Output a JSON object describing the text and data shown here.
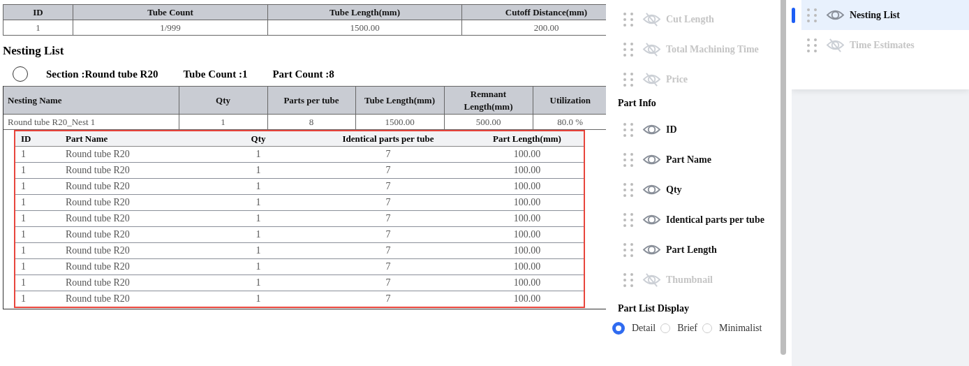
{
  "summary_table": {
    "columns": [
      "ID",
      "Tube Count",
      "Tube Length(mm)",
      "Cutoff Distance(mm)"
    ],
    "rows": [
      [
        "1",
        "1/999",
        "1500.00",
        "200.00"
      ]
    ]
  },
  "nesting_list": {
    "title": "Nesting List",
    "section_info": [
      "Section :Round tube R20",
      "Tube Count :1",
      "Part Count :8"
    ],
    "columns": [
      "Nesting Name",
      "Qty",
      "Parts per tube",
      "Tube Length(mm)",
      "Remnant Length(mm)",
      "Utilization"
    ],
    "rows": [
      [
        "Round tube R20_Nest 1",
        "1",
        "8",
        "1500.00",
        "500.00",
        "80.0 %"
      ]
    ],
    "part_table": {
      "columns": [
        "ID",
        "Part Name",
        "Qty",
        "Identical parts per tube",
        "Part Length(mm)"
      ],
      "rows": [
        [
          "1",
          "Round tube R20",
          "1",
          "7",
          "100.00"
        ],
        [
          "1",
          "Round tube R20",
          "1",
          "7",
          "100.00"
        ],
        [
          "1",
          "Round tube R20",
          "1",
          "7",
          "100.00"
        ],
        [
          "1",
          "Round tube R20",
          "1",
          "7",
          "100.00"
        ],
        [
          "1",
          "Round tube R20",
          "1",
          "7",
          "100.00"
        ],
        [
          "1",
          "Round tube R20",
          "1",
          "7",
          "100.00"
        ],
        [
          "1",
          "Round tube R20",
          "1",
          "7",
          "100.00"
        ],
        [
          "1",
          "Round tube R20",
          "1",
          "7",
          "100.00"
        ],
        [
          "1",
          "Round tube R20",
          "1",
          "7",
          "100.00"
        ],
        [
          "1",
          "Round tube R20",
          "1",
          "7",
          "100.00"
        ]
      ]
    }
  },
  "field_panel": {
    "groups": [
      {
        "items": [
          {
            "label": "Cut Length",
            "visible": false
          },
          {
            "label": "Total Machining Time",
            "visible": false
          },
          {
            "label": "Price",
            "visible": false
          }
        ]
      },
      {
        "title": "Part Info",
        "items": [
          {
            "label": "ID",
            "visible": true
          },
          {
            "label": "Part Name",
            "visible": true
          },
          {
            "label": "Qty",
            "visible": true
          },
          {
            "label": "Identical parts per tube",
            "visible": true
          },
          {
            "label": "Part Length",
            "visible": true
          },
          {
            "label": "Thumbnail",
            "visible": false
          }
        ]
      }
    ],
    "part_list_display": {
      "title": "Part List Display",
      "options": [
        {
          "label": "Detail",
          "selected": true
        },
        {
          "label": "Brief",
          "selected": false
        },
        {
          "label": "Minimalist",
          "selected": false
        }
      ]
    }
  },
  "section_panel": {
    "items": [
      {
        "label": "Nesting List",
        "visible": true,
        "selected": true
      },
      {
        "label": "Time Estimates",
        "visible": false,
        "selected": false
      }
    ]
  }
}
